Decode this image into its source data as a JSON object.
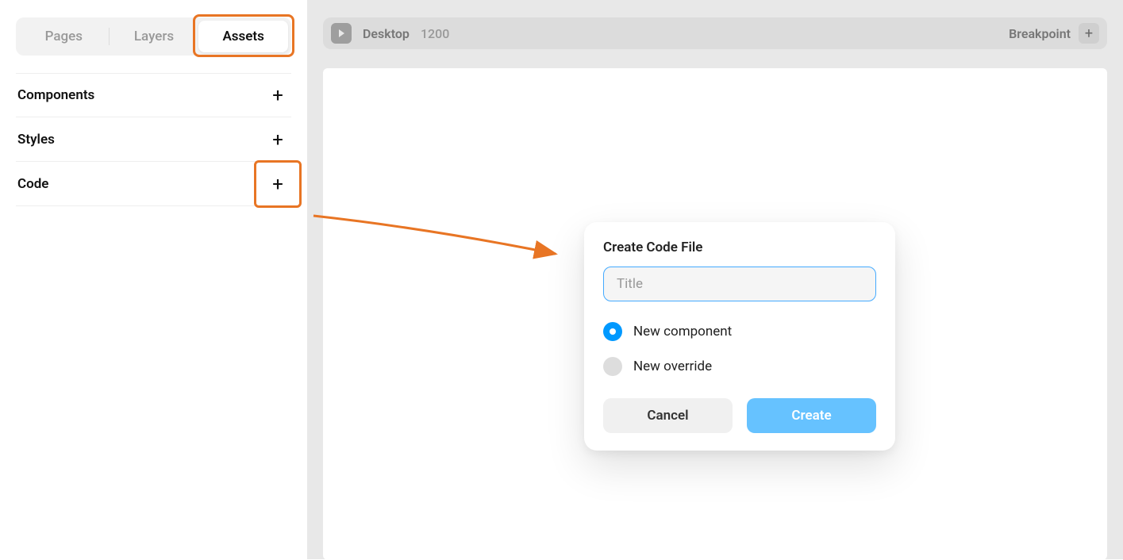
{
  "sidebar": {
    "tabs": {
      "pages": "Pages",
      "layers": "Layers",
      "assets": "Assets"
    },
    "sections": {
      "components": "Components",
      "styles": "Styles",
      "code": "Code"
    }
  },
  "breakpoint_bar": {
    "title": "Desktop",
    "size": "1200",
    "label": "Breakpoint"
  },
  "modal": {
    "title": "Create Code File",
    "input_placeholder": "Title",
    "input_value": "",
    "option_new_component": "New component",
    "option_new_override": "New override",
    "cancel": "Cancel",
    "create": "Create"
  },
  "highlight_color": "#e87524"
}
